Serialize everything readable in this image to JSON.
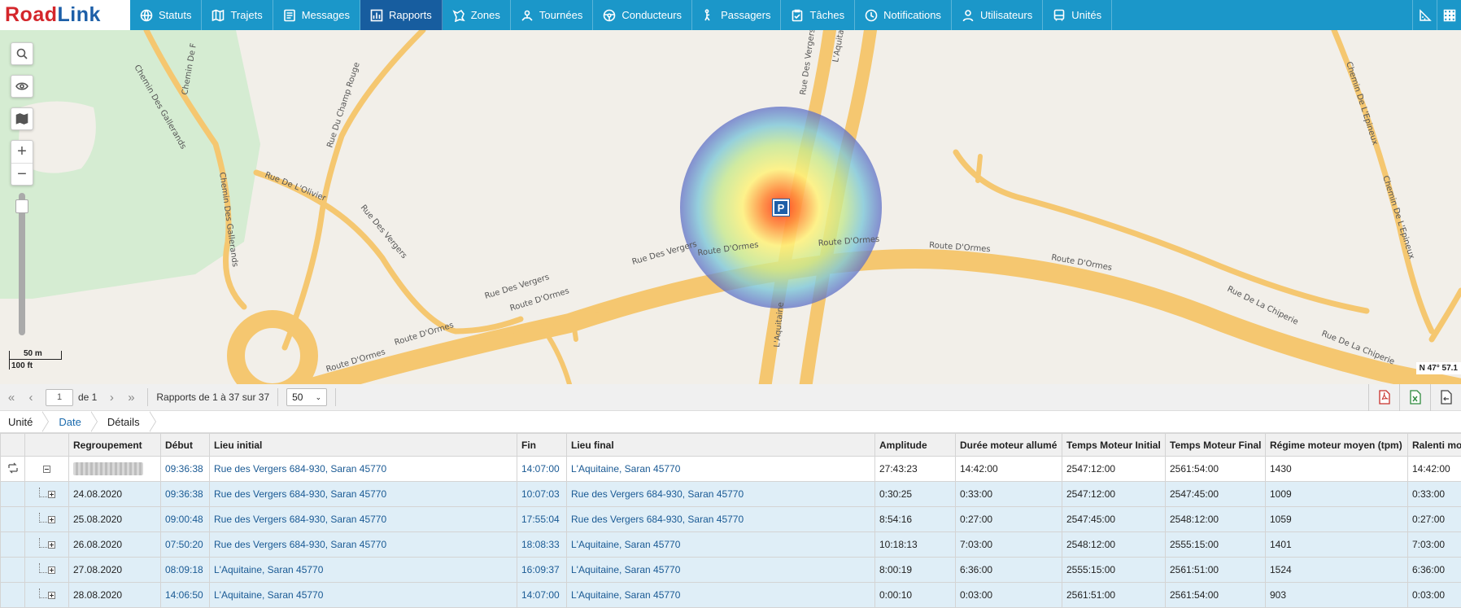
{
  "brand": {
    "part1": "Road",
    "part2": "Link"
  },
  "nav": [
    {
      "label": "Statuts",
      "icon": "globe-icon"
    },
    {
      "label": "Trajets",
      "icon": "map-icon"
    },
    {
      "label": "Messages",
      "icon": "messages-icon"
    },
    {
      "label": "Rapports",
      "icon": "chart-icon",
      "active": true
    },
    {
      "label": "Zones",
      "icon": "zones-icon"
    },
    {
      "label": "Tournées",
      "icon": "route-icon"
    },
    {
      "label": "Conducteurs",
      "icon": "steering-wheel-icon"
    },
    {
      "label": "Passagers",
      "icon": "passenger-icon"
    },
    {
      "label": "Tâches",
      "icon": "task-icon"
    },
    {
      "label": "Notifications",
      "icon": "clock-icon"
    },
    {
      "label": "Utilisateurs",
      "icon": "user-icon"
    },
    {
      "label": "Unités",
      "icon": "bus-icon"
    }
  ],
  "map": {
    "scale_m": "50 m",
    "scale_ft": "100 ft",
    "coords": "N 47° 57.1",
    "marker": "P",
    "streets": [
      "Rue Des Vergers",
      "Route D'Ormes",
      "Rue Du Champ Rouge",
      "Rue De L'Olivier",
      "Chemin Des Gallerands",
      "Chemin De F",
      "L'Aquitaine",
      "Chemin De L'Epineux",
      "Rue De La Chiperie",
      "Rue De",
      "Rue D"
    ]
  },
  "pager": {
    "page": "1",
    "of": "de 1",
    "summary": "Rapports de 1 à 37 sur 37",
    "per_page": "50"
  },
  "breadcrumb": [
    "Unité",
    "Date",
    "Détails"
  ],
  "table": {
    "headers": [
      "Regroupement",
      "Début",
      "Lieu initial",
      "Fin",
      "Lieu final",
      "Amplitude",
      "Durée moteur allumé",
      "Temps Moteur Initial",
      "Temps Moteur Final",
      "Régime moteur moyen (tpm)",
      "Ralenti moteur"
    ],
    "total": [
      "",
      "09:36:38",
      "Rue des Vergers 684-930, Saran 45770",
      "14:07:00",
      "L'Aquitaine, Saran 45770",
      "27:43:23",
      "14:42:00",
      "2547:12:00",
      "2561:54:00",
      "1430",
      "14:42:00"
    ],
    "rows": [
      [
        "24.08.2020",
        "09:36:38",
        "Rue des Vergers 684-930, Saran 45770",
        "10:07:03",
        "Rue des Vergers 684-930, Saran 45770",
        "0:30:25",
        "0:33:00",
        "2547:12:00",
        "2547:45:00",
        "1009",
        "0:33:00"
      ],
      [
        "25.08.2020",
        "09:00:48",
        "Rue des Vergers 684-930, Saran 45770",
        "17:55:04",
        "Rue des Vergers 684-930, Saran 45770",
        "8:54:16",
        "0:27:00",
        "2547:45:00",
        "2548:12:00",
        "1059",
        "0:27:00"
      ],
      [
        "26.08.2020",
        "07:50:20",
        "Rue des Vergers 684-930, Saran 45770",
        "18:08:33",
        "L'Aquitaine, Saran 45770",
        "10:18:13",
        "7:03:00",
        "2548:12:00",
        "2555:15:00",
        "1401",
        "7:03:00"
      ],
      [
        "27.08.2020",
        "08:09:18",
        "L'Aquitaine, Saran 45770",
        "16:09:37",
        "L'Aquitaine, Saran 45770",
        "8:00:19",
        "6:36:00",
        "2555:15:00",
        "2561:51:00",
        "1524",
        "6:36:00"
      ],
      [
        "28.08.2020",
        "14:06:50",
        "L'Aquitaine, Saran 45770",
        "14:07:00",
        "L'Aquitaine, Saran 45770",
        "0:00:10",
        "0:03:00",
        "2561:51:00",
        "2561:54:00",
        "903",
        "0:03:00"
      ]
    ]
  },
  "colors": {
    "nav": "#1b97c9",
    "nav_active": "#175d9f",
    "link": "#1a5a94",
    "row_sub": "#dfeef7",
    "road": "#fcd98a"
  }
}
